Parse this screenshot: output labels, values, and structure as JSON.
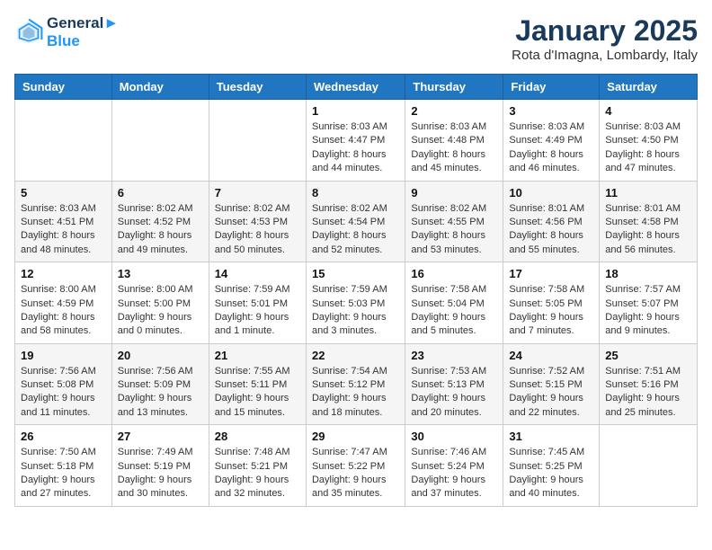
{
  "header": {
    "logo_line1": "General",
    "logo_line2": "Blue",
    "month_year": "January 2025",
    "location": "Rota d'Imagna, Lombardy, Italy"
  },
  "weekdays": [
    "Sunday",
    "Monday",
    "Tuesday",
    "Wednesday",
    "Thursday",
    "Friday",
    "Saturday"
  ],
  "weeks": [
    [
      {
        "day": "",
        "info": ""
      },
      {
        "day": "",
        "info": ""
      },
      {
        "day": "",
        "info": ""
      },
      {
        "day": "1",
        "info": "Sunrise: 8:03 AM\nSunset: 4:47 PM\nDaylight: 8 hours\nand 44 minutes."
      },
      {
        "day": "2",
        "info": "Sunrise: 8:03 AM\nSunset: 4:48 PM\nDaylight: 8 hours\nand 45 minutes."
      },
      {
        "day": "3",
        "info": "Sunrise: 8:03 AM\nSunset: 4:49 PM\nDaylight: 8 hours\nand 46 minutes."
      },
      {
        "day": "4",
        "info": "Sunrise: 8:03 AM\nSunset: 4:50 PM\nDaylight: 8 hours\nand 47 minutes."
      }
    ],
    [
      {
        "day": "5",
        "info": "Sunrise: 8:03 AM\nSunset: 4:51 PM\nDaylight: 8 hours\nand 48 minutes."
      },
      {
        "day": "6",
        "info": "Sunrise: 8:02 AM\nSunset: 4:52 PM\nDaylight: 8 hours\nand 49 minutes."
      },
      {
        "day": "7",
        "info": "Sunrise: 8:02 AM\nSunset: 4:53 PM\nDaylight: 8 hours\nand 50 minutes."
      },
      {
        "day": "8",
        "info": "Sunrise: 8:02 AM\nSunset: 4:54 PM\nDaylight: 8 hours\nand 52 minutes."
      },
      {
        "day": "9",
        "info": "Sunrise: 8:02 AM\nSunset: 4:55 PM\nDaylight: 8 hours\nand 53 minutes."
      },
      {
        "day": "10",
        "info": "Sunrise: 8:01 AM\nSunset: 4:56 PM\nDaylight: 8 hours\nand 55 minutes."
      },
      {
        "day": "11",
        "info": "Sunrise: 8:01 AM\nSunset: 4:58 PM\nDaylight: 8 hours\nand 56 minutes."
      }
    ],
    [
      {
        "day": "12",
        "info": "Sunrise: 8:00 AM\nSunset: 4:59 PM\nDaylight: 8 hours\nand 58 minutes."
      },
      {
        "day": "13",
        "info": "Sunrise: 8:00 AM\nSunset: 5:00 PM\nDaylight: 9 hours\nand 0 minutes."
      },
      {
        "day": "14",
        "info": "Sunrise: 7:59 AM\nSunset: 5:01 PM\nDaylight: 9 hours\nand 1 minute."
      },
      {
        "day": "15",
        "info": "Sunrise: 7:59 AM\nSunset: 5:03 PM\nDaylight: 9 hours\nand 3 minutes."
      },
      {
        "day": "16",
        "info": "Sunrise: 7:58 AM\nSunset: 5:04 PM\nDaylight: 9 hours\nand 5 minutes."
      },
      {
        "day": "17",
        "info": "Sunrise: 7:58 AM\nSunset: 5:05 PM\nDaylight: 9 hours\nand 7 minutes."
      },
      {
        "day": "18",
        "info": "Sunrise: 7:57 AM\nSunset: 5:07 PM\nDaylight: 9 hours\nand 9 minutes."
      }
    ],
    [
      {
        "day": "19",
        "info": "Sunrise: 7:56 AM\nSunset: 5:08 PM\nDaylight: 9 hours\nand 11 minutes."
      },
      {
        "day": "20",
        "info": "Sunrise: 7:56 AM\nSunset: 5:09 PM\nDaylight: 9 hours\nand 13 minutes."
      },
      {
        "day": "21",
        "info": "Sunrise: 7:55 AM\nSunset: 5:11 PM\nDaylight: 9 hours\nand 15 minutes."
      },
      {
        "day": "22",
        "info": "Sunrise: 7:54 AM\nSunset: 5:12 PM\nDaylight: 9 hours\nand 18 minutes."
      },
      {
        "day": "23",
        "info": "Sunrise: 7:53 AM\nSunset: 5:13 PM\nDaylight: 9 hours\nand 20 minutes."
      },
      {
        "day": "24",
        "info": "Sunrise: 7:52 AM\nSunset: 5:15 PM\nDaylight: 9 hours\nand 22 minutes."
      },
      {
        "day": "25",
        "info": "Sunrise: 7:51 AM\nSunset: 5:16 PM\nDaylight: 9 hours\nand 25 minutes."
      }
    ],
    [
      {
        "day": "26",
        "info": "Sunrise: 7:50 AM\nSunset: 5:18 PM\nDaylight: 9 hours\nand 27 minutes."
      },
      {
        "day": "27",
        "info": "Sunrise: 7:49 AM\nSunset: 5:19 PM\nDaylight: 9 hours\nand 30 minutes."
      },
      {
        "day": "28",
        "info": "Sunrise: 7:48 AM\nSunset: 5:21 PM\nDaylight: 9 hours\nand 32 minutes."
      },
      {
        "day": "29",
        "info": "Sunrise: 7:47 AM\nSunset: 5:22 PM\nDaylight: 9 hours\nand 35 minutes."
      },
      {
        "day": "30",
        "info": "Sunrise: 7:46 AM\nSunset: 5:24 PM\nDaylight: 9 hours\nand 37 minutes."
      },
      {
        "day": "31",
        "info": "Sunrise: 7:45 AM\nSunset: 5:25 PM\nDaylight: 9 hours\nand 40 minutes."
      },
      {
        "day": "",
        "info": ""
      }
    ]
  ]
}
